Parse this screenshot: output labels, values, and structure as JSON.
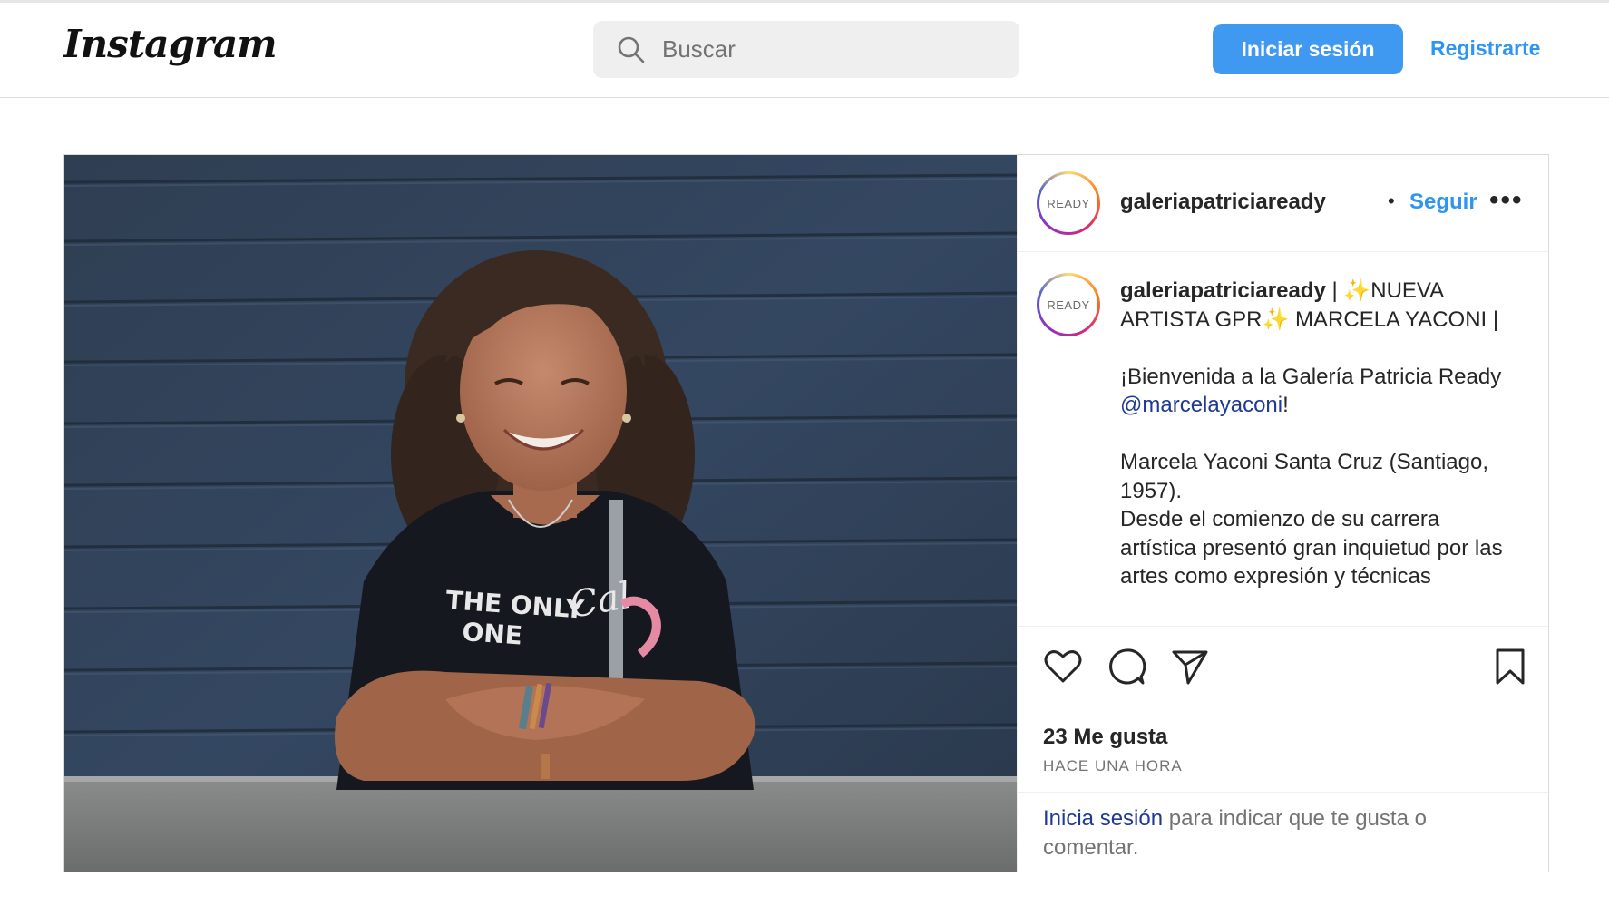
{
  "header": {
    "logo_text": "Instagram",
    "search": {
      "placeholder": "Buscar"
    },
    "login_label": "Iniciar sesión",
    "signup_label": "Registrarte"
  },
  "post": {
    "username": "galeriapatriciaready",
    "avatar_text": "READY",
    "separator": "•",
    "follow_label": "Seguir",
    "more_label": "•••",
    "caption": {
      "title_part1": " | ✨NUEVA ARTISTA GPR✨ MARCELA YACONI |",
      "welcome_prefix": "¡Bienvenida a la Galería Patricia Ready ",
      "mention": "@marcelayaconi",
      "welcome_suffix": "!",
      "bio_line1": "Marcela Yaconi Santa Cruz (Santiago, 1957).",
      "bio_line2": "Desde el comienzo de su carrera artística presentó gran inquietud por las artes como expresión y técnicas"
    },
    "likes": "23 Me gusta",
    "time": "HACE UNA HORA",
    "footer": {
      "login_link": "Inicia sesión",
      "rest": " para indicar que te gusta o comentar."
    },
    "photo_shirt_text": [
      "THE ONLY",
      "ONE"
    ]
  },
  "colors": {
    "primary_button": "#4099f0",
    "link_blue": "#2e96f2",
    "mention_blue": "#1f3a93",
    "border": "#dbdbdb",
    "search_bg": "#efefef"
  }
}
